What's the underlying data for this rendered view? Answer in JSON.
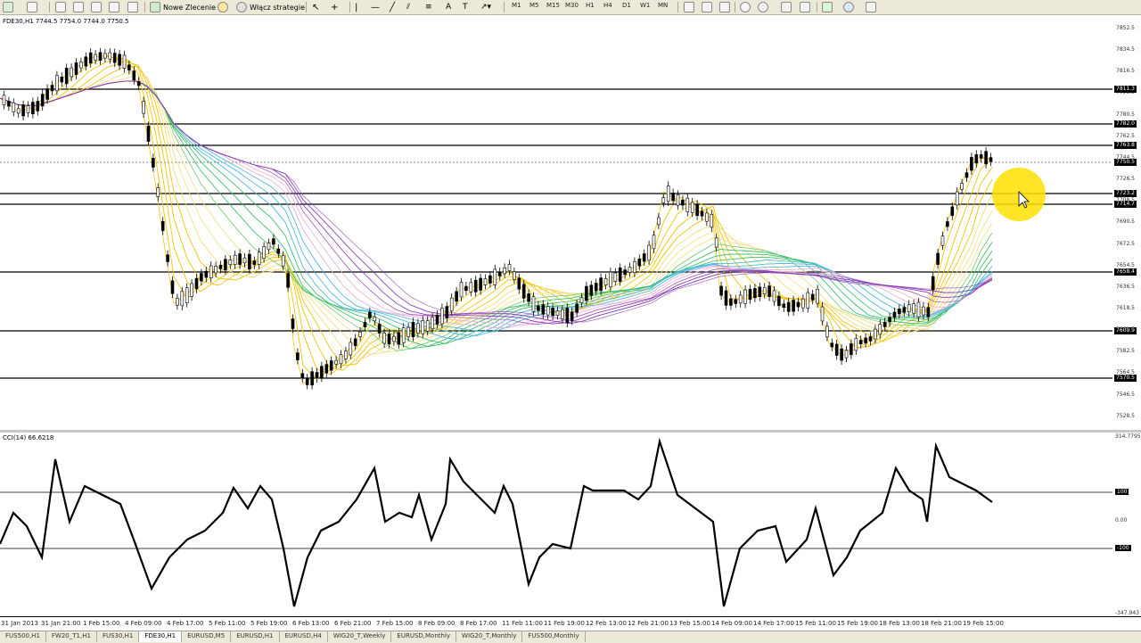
{
  "toolbar": {
    "new_order": "Nowe Zlecenie",
    "enable_strategies": "Włącz strategie",
    "timeframes": [
      "M1",
      "M5",
      "M15",
      "M30",
      "H1",
      "H4",
      "D1",
      "W1",
      "MN"
    ]
  },
  "chart": {
    "header": "FDE30,H1  7744.5 7754.0 7744.0 7750.5",
    "price_ticks": [
      "7852.5",
      "7834.5",
      "7816.5",
      "7798.5",
      "7780.5",
      "7762.5",
      "7744.5",
      "7726.5",
      "7708.5",
      "7690.5",
      "7672.5",
      "7654.5",
      "7636.5",
      "7618.5",
      "7600.5",
      "7582.5",
      "7564.5",
      "7546.5",
      "7528.5"
    ],
    "levels": [
      "7811.3",
      "7782.0",
      "7763.8",
      "7750.5",
      "7723.2",
      "7714.7",
      "7658.4",
      "7609.9",
      "7570.5"
    ],
    "accent_colors": {
      "candle_up": "#ffffff",
      "candle_down": "#000000",
      "ribbon_fast": "#f2c300",
      "ribbon_mid": "#3cc26b",
      "ribbon_slow": "#8a3fb8",
      "cursor_highlight": "#ffe100"
    }
  },
  "cci": {
    "header": "CCI(14) 66.6218",
    "axis": [
      "314.7795",
      "100",
      "0.00",
      "-100",
      "-347.943"
    ]
  },
  "time_axis": [
    "31 Jan 2013",
    "31 Jan 21:00",
    "1 Feb 15:00",
    "4 Feb 09:00",
    "4 Feb 17:00",
    "5 Feb 11:00",
    "5 Feb 19:00",
    "6 Feb 13:00",
    "6 Feb 21:00",
    "7 Feb 15:00",
    "8 Feb 09:00",
    "8 Feb 17:00",
    "11 Feb 11:00",
    "11 Feb 19:00",
    "12 Feb 13:00",
    "12 Feb 21:00",
    "13 Feb 15:00",
    "14 Feb 09:00",
    "14 Feb 17:00",
    "15 Feb 11:00",
    "15 Feb 19:00",
    "18 Feb 13:00",
    "18 Feb 21:00",
    "19 Feb 15:00"
  ],
  "tabs": [
    "FUS500,H1",
    "FW20_T1,H1",
    "FUS30,H1",
    "FDE30,H1",
    "EURUSD,M5",
    "EURUSD,H1",
    "EURUSD,H4",
    "WIG20_T,Weekly",
    "EURUSD,Monthly",
    "WIG20_T,Monthly",
    "FUS500,Monthly"
  ],
  "active_tab": "FDE30,H1"
}
